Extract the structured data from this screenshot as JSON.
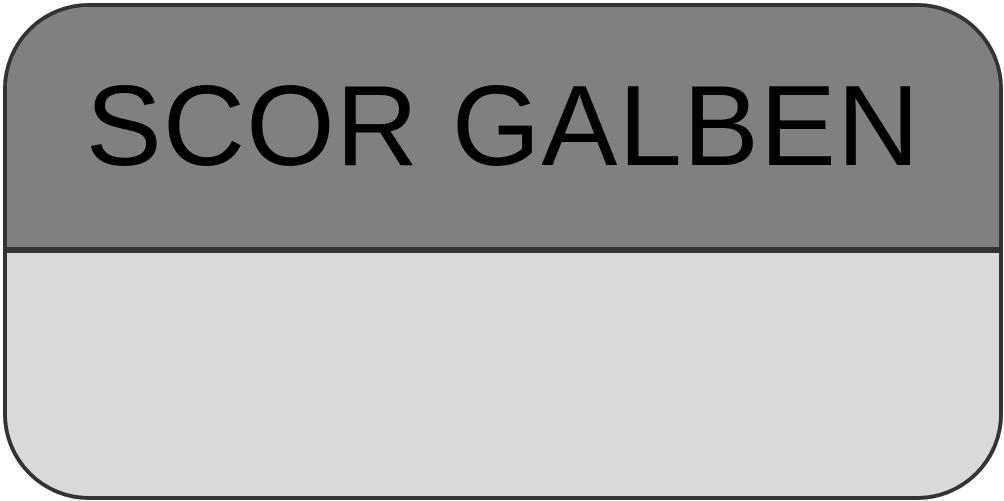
{
  "label": {
    "title": "SCOR GALBEN"
  },
  "colors": {
    "header_fill": "#808080",
    "body_fill": "#d9d9d9",
    "border": "#333333",
    "text": "#000000"
  }
}
